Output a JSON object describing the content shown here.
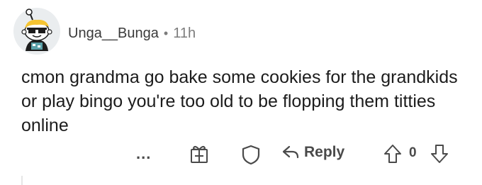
{
  "comment": {
    "username": "Unga__Bunga",
    "separator": "•",
    "time_ago": "11h",
    "text": "cmon grandma go bake some cookies for the grandkids or play bingo you're too old to be flopping them titties online",
    "actions": {
      "more_label": "...",
      "reply_label": "Reply",
      "vote_count": "0"
    },
    "icons": {
      "avatar": "snoo-avatar-sunglasses",
      "award": "gift-icon",
      "save": "shield-icon",
      "reply": "reply-arrow-icon",
      "upvote": "upvote-arrow-icon",
      "downvote": "downvote-arrow-icon"
    }
  }
}
